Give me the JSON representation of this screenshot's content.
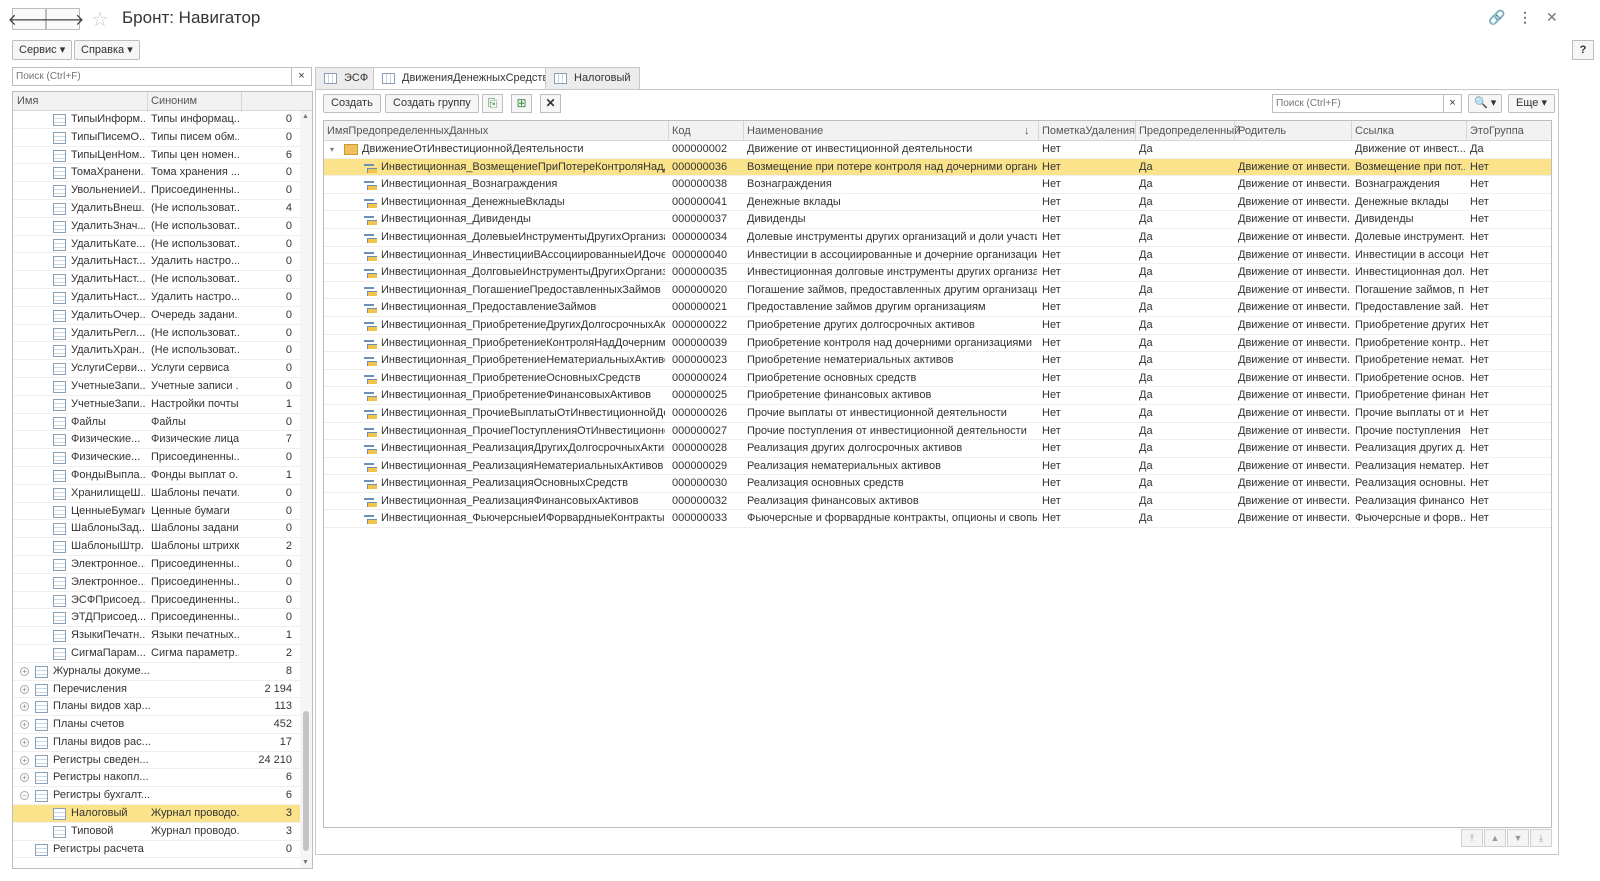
{
  "window": {
    "title": "Бронт: Навигатор",
    "back_icon": "arrow-left-icon",
    "forward_icon": "arrow-right-icon",
    "fav_icon": "star-icon"
  },
  "menu": {
    "service": "Сервис ▾",
    "help": "Справка ▾",
    "question": "?"
  },
  "left": {
    "search_placeholder": "Поиск (Ctrl+F)",
    "clear": "×",
    "col_name": "Имя",
    "col_synonym": "Синоним",
    "rows": [
      {
        "name": "ТипыИнформ...",
        "syn": "Типы информац...",
        "n": "0",
        "lvl": 2
      },
      {
        "name": "ТипыПисемО...",
        "syn": "Типы писем обм...",
        "n": "0",
        "lvl": 2
      },
      {
        "name": "ТипыЦенНом...",
        "syn": "Типы цен номен...",
        "n": "6",
        "lvl": 2
      },
      {
        "name": "ТомаХранени...",
        "syn": "Тома хранения ...",
        "n": "0",
        "lvl": 2
      },
      {
        "name": "УвольнениеИ...",
        "syn": "Присоединенны...",
        "n": "0",
        "lvl": 2
      },
      {
        "name": "УдалитьВнеш...",
        "syn": "(Не использоват...",
        "n": "4",
        "lvl": 2
      },
      {
        "name": "УдалитьЗнач...",
        "syn": "(Не использоват...",
        "n": "0",
        "lvl": 2
      },
      {
        "name": "УдалитьКате...",
        "syn": "(Не использоват...",
        "n": "0",
        "lvl": 2
      },
      {
        "name": "УдалитьНаст...",
        "syn": "Удалить настро...",
        "n": "0",
        "lvl": 2
      },
      {
        "name": "УдалитьНаст...",
        "syn": "(Не использоват...",
        "n": "0",
        "lvl": 2
      },
      {
        "name": "УдалитьНаст...",
        "syn": "Удалить настро...",
        "n": "0",
        "lvl": 2
      },
      {
        "name": "УдалитьОчер...",
        "syn": "Очередь задани...",
        "n": "0",
        "lvl": 2
      },
      {
        "name": "УдалитьРегл...",
        "syn": "(Не использоват...",
        "n": "0",
        "lvl": 2
      },
      {
        "name": "УдалитьХран...",
        "syn": "(Не использоват...",
        "n": "0",
        "lvl": 2
      },
      {
        "name": "УслугиСерви...",
        "syn": "Услуги сервиса",
        "n": "0",
        "lvl": 2
      },
      {
        "name": "УчетныеЗапи...",
        "syn": "Учетные записи ...",
        "n": "0",
        "lvl": 2
      },
      {
        "name": "УчетныеЗапи...",
        "syn": "Настройки почты",
        "n": "1",
        "lvl": 2
      },
      {
        "name": "Файлы",
        "syn": "Файлы",
        "n": "0",
        "lvl": 2
      },
      {
        "name": "Физические...",
        "syn": "Физические лица",
        "n": "7",
        "lvl": 2
      },
      {
        "name": "Физические...",
        "syn": "Присоединенны...",
        "n": "0",
        "lvl": 2
      },
      {
        "name": "ФондыВыпла...",
        "syn": "Фонды выплат о...",
        "n": "1",
        "lvl": 2
      },
      {
        "name": "ХранилищеШ...",
        "syn": "Шаблоны печати...",
        "n": "0",
        "lvl": 2
      },
      {
        "name": "ЦенныеБумаги",
        "syn": "Ценные бумаги",
        "n": "0",
        "lvl": 2
      },
      {
        "name": "ШаблоныЗад...",
        "syn": "Шаблоны задани...",
        "n": "0",
        "lvl": 2
      },
      {
        "name": "ШаблоныШтр...",
        "syn": "Шаблоны штрихк...",
        "n": "2",
        "lvl": 2
      },
      {
        "name": "Электронное...",
        "syn": "Присоединенны...",
        "n": "0",
        "lvl": 2
      },
      {
        "name": "Электронное...",
        "syn": "Присоединенны...",
        "n": "0",
        "lvl": 2
      },
      {
        "name": "ЭСФПрисоед...",
        "syn": "Присоединенны...",
        "n": "0",
        "lvl": 2
      },
      {
        "name": "ЭТДПрисоед...",
        "syn": "Присоединенны...",
        "n": "0",
        "lvl": 2
      },
      {
        "name": "ЯзыкиПечатн...",
        "syn": "Языки печатных...",
        "n": "1",
        "lvl": 2
      },
      {
        "name": "СигмаПарам...",
        "syn": "Сигма параметр...",
        "n": "2",
        "lvl": 2
      },
      {
        "name": "Журналы докуме...",
        "syn": "",
        "n": "8",
        "lvl": 1,
        "exp": "+",
        "icon": "journal-icon"
      },
      {
        "name": "Перечисления",
        "syn": "",
        "n": "2 194",
        "lvl": 1,
        "exp": "+",
        "icon": "enum-icon"
      },
      {
        "name": "Планы видов хар...",
        "syn": "",
        "n": "113",
        "lvl": 1,
        "exp": "+",
        "icon": "chart-of-characteristics-icon"
      },
      {
        "name": "Планы счетов",
        "syn": "",
        "n": "452",
        "lvl": 1,
        "exp": "+",
        "icon": "chart-of-accounts-icon"
      },
      {
        "name": "Планы видов рас...",
        "syn": "",
        "n": "17",
        "lvl": 1,
        "exp": "+",
        "icon": "calc-types-icon"
      },
      {
        "name": "Регистры сведен...",
        "syn": "",
        "n": "24 210",
        "lvl": 1,
        "exp": "+",
        "icon": "info-register-icon"
      },
      {
        "name": "Регистры накопл...",
        "syn": "",
        "n": "6",
        "lvl": 1,
        "exp": "+",
        "icon": "accum-register-icon"
      },
      {
        "name": "Регистры бухгалт...",
        "syn": "",
        "n": "6",
        "lvl": 1,
        "exp": "−",
        "icon": "accounting-register-icon"
      },
      {
        "name": "Налоговый",
        "syn": "Журнал проводо...",
        "n": "3",
        "lvl": 2,
        "sel": true,
        "icon": "accounting-register-icon"
      },
      {
        "name": "Типовой",
        "syn": "Журнал проводо...",
        "n": "3",
        "lvl": 2,
        "icon": "accounting-register-icon"
      },
      {
        "name": "Регистры расчета",
        "syn": "",
        "n": "0",
        "lvl": 1,
        "icon": "calc-register-icon"
      }
    ]
  },
  "tabs": [
    {
      "label": "ЭСФ"
    },
    {
      "label": "ДвиженияДенежныхСредств"
    },
    {
      "label": "Налоговый"
    }
  ],
  "toolbar": {
    "create": "Создать",
    "create_group": "Создать группу",
    "search_placeholder": "Поиск (Ctrl+F)",
    "clear": "×",
    "more": "Еще ▾",
    "search_btn": "🔍 ▾"
  },
  "grid": {
    "columns": [
      "ИмяПредопределенныхДанных",
      "Код",
      "Наименование",
      "ПометкаУдаления",
      "Предопределенный",
      "Родитель",
      "Ссылка",
      "ЭтоГруппа"
    ],
    "sort_arrow": "↓",
    "rows": [
      {
        "name": "ДвижениеОтИнвестиционнойДеятельности",
        "code": "000000002",
        "title": "Движение от инвестиционной деятельности",
        "del": "Нет",
        "pre": "Да",
        "parent": "",
        "ref": "Движение от инвест...",
        "grp": "Да",
        "folder": true
      },
      {
        "name": "Инвестиционная_ВозмещениеПриПотереКонтроляНадДоч...",
        "code": "000000036",
        "title": "Возмещение при потере контроля над дочерними организа...",
        "del": "Нет",
        "pre": "Да",
        "parent": "Движение от инвести...",
        "ref": "Возмещение при пот...",
        "grp": "Нет",
        "sel": true
      },
      {
        "name": "Инвестиционная_Вознаграждения",
        "code": "000000038",
        "title": "Вознаграждения",
        "del": "Нет",
        "pre": "Да",
        "parent": "Движение от инвести...",
        "ref": "Вознаграждения",
        "grp": "Нет"
      },
      {
        "name": "Инвестиционная_ДенежныеВклады",
        "code": "000000041",
        "title": "Денежные вклады",
        "del": "Нет",
        "pre": "Да",
        "parent": "Движение от инвести...",
        "ref": "Денежные вклады",
        "grp": "Нет"
      },
      {
        "name": "Инвестиционная_Дивиденды",
        "code": "000000037",
        "title": "Дивиденды",
        "del": "Нет",
        "pre": "Да",
        "parent": "Движение от инвести...",
        "ref": "Дивиденды",
        "grp": "Нет"
      },
      {
        "name": "Инвестиционная_ДолевыеИнструментыДругихОрганизац...",
        "code": "000000034",
        "title": "Долевые инструменты других организаций и доли участия ...",
        "del": "Нет",
        "pre": "Да",
        "parent": "Движение от инвести...",
        "ref": "Долевые инструмент...",
        "grp": "Нет"
      },
      {
        "name": "Инвестиционная_ИнвестицииВАссоциированныеИДочерн...",
        "code": "000000040",
        "title": "Инвестиции в ассоциированные и дочерние организации",
        "del": "Нет",
        "pre": "Да",
        "parent": "Движение от инвести...",
        "ref": "Инвестиции в ассоци...",
        "grp": "Нет"
      },
      {
        "name": "Инвестиционная_ДолговыеИнструментыДругихОрганиза...",
        "code": "000000035",
        "title": "Инвестиционная долговые инструменты других организац...",
        "del": "Нет",
        "pre": "Да",
        "parent": "Движение от инвести...",
        "ref": "Инвестиционная дол...",
        "grp": "Нет"
      },
      {
        "name": "Инвестиционная_ПогашениеПредоставленныхЗаймов",
        "code": "000000020",
        "title": "Погашение займов, предоставленных другим организациям",
        "del": "Нет",
        "pre": "Да",
        "parent": "Движение от инвести...",
        "ref": "Погашение займов, п...",
        "grp": "Нет"
      },
      {
        "name": "Инвестиционная_ПредоставлениеЗаймов",
        "code": "000000021",
        "title": "Предоставление займов другим организациям",
        "del": "Нет",
        "pre": "Да",
        "parent": "Движение от инвести...",
        "ref": "Предоставление зай...",
        "grp": "Нет"
      },
      {
        "name": "Инвестиционная_ПриобретениеДругихДолгосрочныхАкти...",
        "code": "000000022",
        "title": "Приобретение других долгосрочных активов",
        "del": "Нет",
        "pre": "Да",
        "parent": "Движение от инвести...",
        "ref": "Приобретение других...",
        "grp": "Нет"
      },
      {
        "name": "Инвестиционная_ПриобретениеКонтроляНадДочернимиО...",
        "code": "000000039",
        "title": "Приобретение контроля над дочерними организациями",
        "del": "Нет",
        "pre": "Да",
        "parent": "Движение от инвести...",
        "ref": "Приобретение контр...",
        "grp": "Нет"
      },
      {
        "name": "Инвестиционная_ПриобретениеНематериальныхАктивов",
        "code": "000000023",
        "title": "Приобретение нематериальных активов",
        "del": "Нет",
        "pre": "Да",
        "parent": "Движение от инвести...",
        "ref": "Приобретение немат...",
        "grp": "Нет"
      },
      {
        "name": "Инвестиционная_ПриобретениеОсновныхСредств",
        "code": "000000024",
        "title": "Приобретение основных средств",
        "del": "Нет",
        "pre": "Да",
        "parent": "Движение от инвести...",
        "ref": "Приобретение основ...",
        "grp": "Нет"
      },
      {
        "name": "Инвестиционная_ПриобретениеФинансовыхАктивов",
        "code": "000000025",
        "title": "Приобретение финансовых активов",
        "del": "Нет",
        "pre": "Да",
        "parent": "Движение от инвести...",
        "ref": "Приобретение финан...",
        "grp": "Нет"
      },
      {
        "name": "Инвестиционная_ПрочиеВыплатыОтИнвестиционнойДеят...",
        "code": "000000026",
        "title": "Прочие выплаты от инвестиционной деятельности",
        "del": "Нет",
        "pre": "Да",
        "parent": "Движение от инвести...",
        "ref": "Прочие выплаты от и...",
        "grp": "Нет"
      },
      {
        "name": "Инвестиционная_ПрочиеПоступленияОтИнвестиционнойД...",
        "code": "000000027",
        "title": "Прочие поступления от инвестиционной деятельности",
        "del": "Нет",
        "pre": "Да",
        "parent": "Движение от инвести...",
        "ref": "Прочие поступления ...",
        "grp": "Нет"
      },
      {
        "name": "Инвестиционная_РеализацияДругихДолгосрочныхАктивов",
        "code": "000000028",
        "title": "Реализация других долгосрочных активов",
        "del": "Нет",
        "pre": "Да",
        "parent": "Движение от инвести...",
        "ref": "Реализация других д...",
        "grp": "Нет"
      },
      {
        "name": "Инвестиционная_РеализацияНематериальныхАктивов",
        "code": "000000029",
        "title": "Реализация нематериальных активов",
        "del": "Нет",
        "pre": "Да",
        "parent": "Движение от инвести...",
        "ref": "Реализация нематер...",
        "grp": "Нет"
      },
      {
        "name": "Инвестиционная_РеализацияОсновныхСредств",
        "code": "000000030",
        "title": "Реализация основных средств",
        "del": "Нет",
        "pre": "Да",
        "parent": "Движение от инвести...",
        "ref": "Реализация основны...",
        "grp": "Нет"
      },
      {
        "name": "Инвестиционная_РеализацияФинансовыхАктивов",
        "code": "000000032",
        "title": "Реализация финансовых активов",
        "del": "Нет",
        "pre": "Да",
        "parent": "Движение от инвести...",
        "ref": "Реализация финансо...",
        "grp": "Нет"
      },
      {
        "name": "Инвестиционная_ФьючерсныеИФорвардныеКонтракты",
        "code": "000000033",
        "title": "Фьючерсные и форвардные контракты, опционы и свопы",
        "del": "Нет",
        "pre": "Да",
        "parent": "Движение от инвести...",
        "ref": "Фьючерсные и форв...",
        "grp": "Нет"
      }
    ]
  },
  "colors": {
    "selection": "#fbe38c",
    "border": "#bdbdbd",
    "header_bg": "#f2f2f2"
  }
}
